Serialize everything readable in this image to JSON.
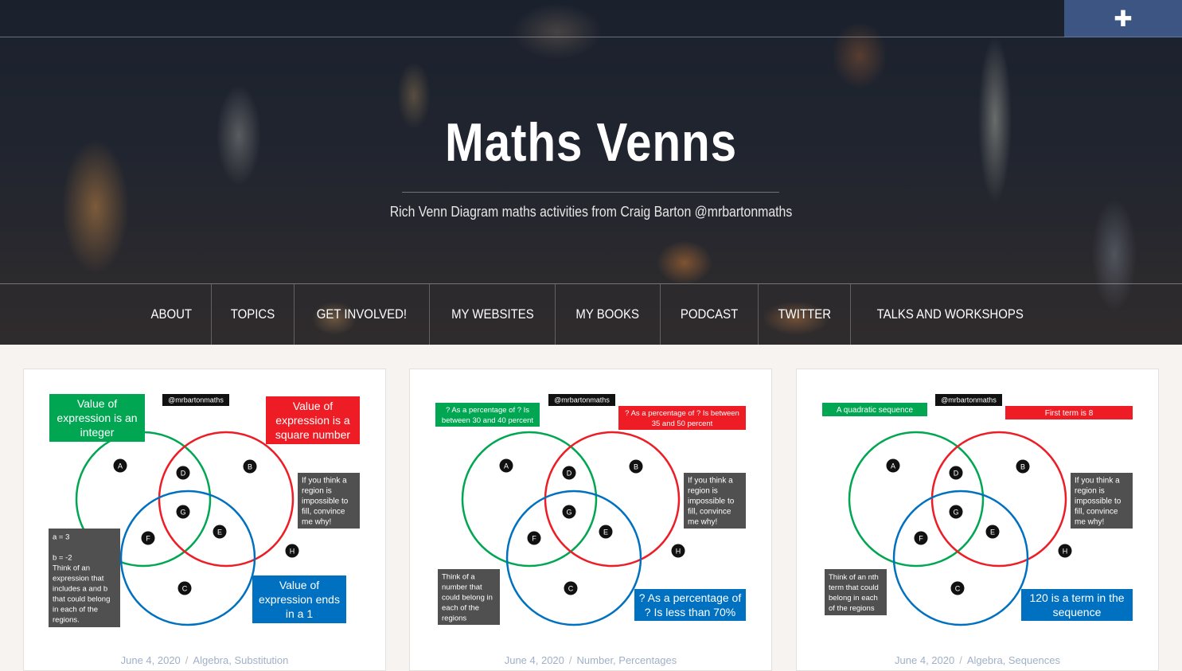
{
  "topbar": {
    "plus_label": "✚"
  },
  "site": {
    "title": "Maths Venns",
    "tagline": "Rich Venn Diagram maths activities from Craig Barton @mrbartonmaths"
  },
  "nav": [
    "ABOUT",
    "TOPICS",
    "GET INVOLVED!",
    "MY WEBSITES",
    "MY BOOKS",
    "PODCAST",
    "TWITTER",
    "TALKS AND WORKSHOPS"
  ],
  "colors": {
    "green": "#00a651",
    "red": "#ee1c25",
    "blue": "#0070c0",
    "dark_box": "#505050"
  },
  "cards": [
    {
      "handle": "@mrbartonmaths",
      "green_label": [
        "Value of",
        "expression is an",
        "integer"
      ],
      "red_label": [
        "Value of",
        "expression is a",
        "square number"
      ],
      "blue_label": [
        "Value of",
        "expression ends",
        "in a 1"
      ],
      "hint": [
        "If you think a",
        "region is",
        "impossible to",
        "fill, convince",
        "me why!"
      ],
      "note": [
        "a = 3",
        "",
        "b = -2",
        "Think of an",
        "expression that",
        "includes a and b",
        "that could belong",
        "in each of the",
        "regions."
      ],
      "date": "June 4, 2020",
      "categories": "Algebra, Substitution"
    },
    {
      "handle": "@mrbartonmaths",
      "green_label": [
        "? As a percentage of ? Is",
        "between 30 and 40 percent"
      ],
      "red_label": [
        "? As a percentage of ? Is between",
        "35 and 50 percent"
      ],
      "blue_label": [
        "? As a percentage of",
        "? Is less than 70%"
      ],
      "hint": [
        "If you think a",
        "region is",
        "impossible to",
        "fill, convince",
        "me why!"
      ],
      "note": [
        "Think of a",
        "number that",
        "could belong in",
        "each of the",
        "regions"
      ],
      "date": "June 4, 2020",
      "categories": "Number, Percentages"
    },
    {
      "handle": "@mrbartonmaths",
      "green_label": [
        "A quadratic sequence"
      ],
      "red_label": [
        "First term is 8"
      ],
      "blue_label": [
        "120 is a term in the",
        "sequence"
      ],
      "hint": [
        "If you think a",
        "region is",
        "impossible to",
        "fill, convince",
        "me why!"
      ],
      "note": [
        "Think of an nth",
        "term that could",
        "belong in each",
        "of the regions"
      ],
      "date": "June 4, 2020",
      "categories": "Algebra, Sequences"
    }
  ],
  "region_letters": [
    "A",
    "B",
    "C",
    "D",
    "E",
    "F",
    "G",
    "H"
  ]
}
